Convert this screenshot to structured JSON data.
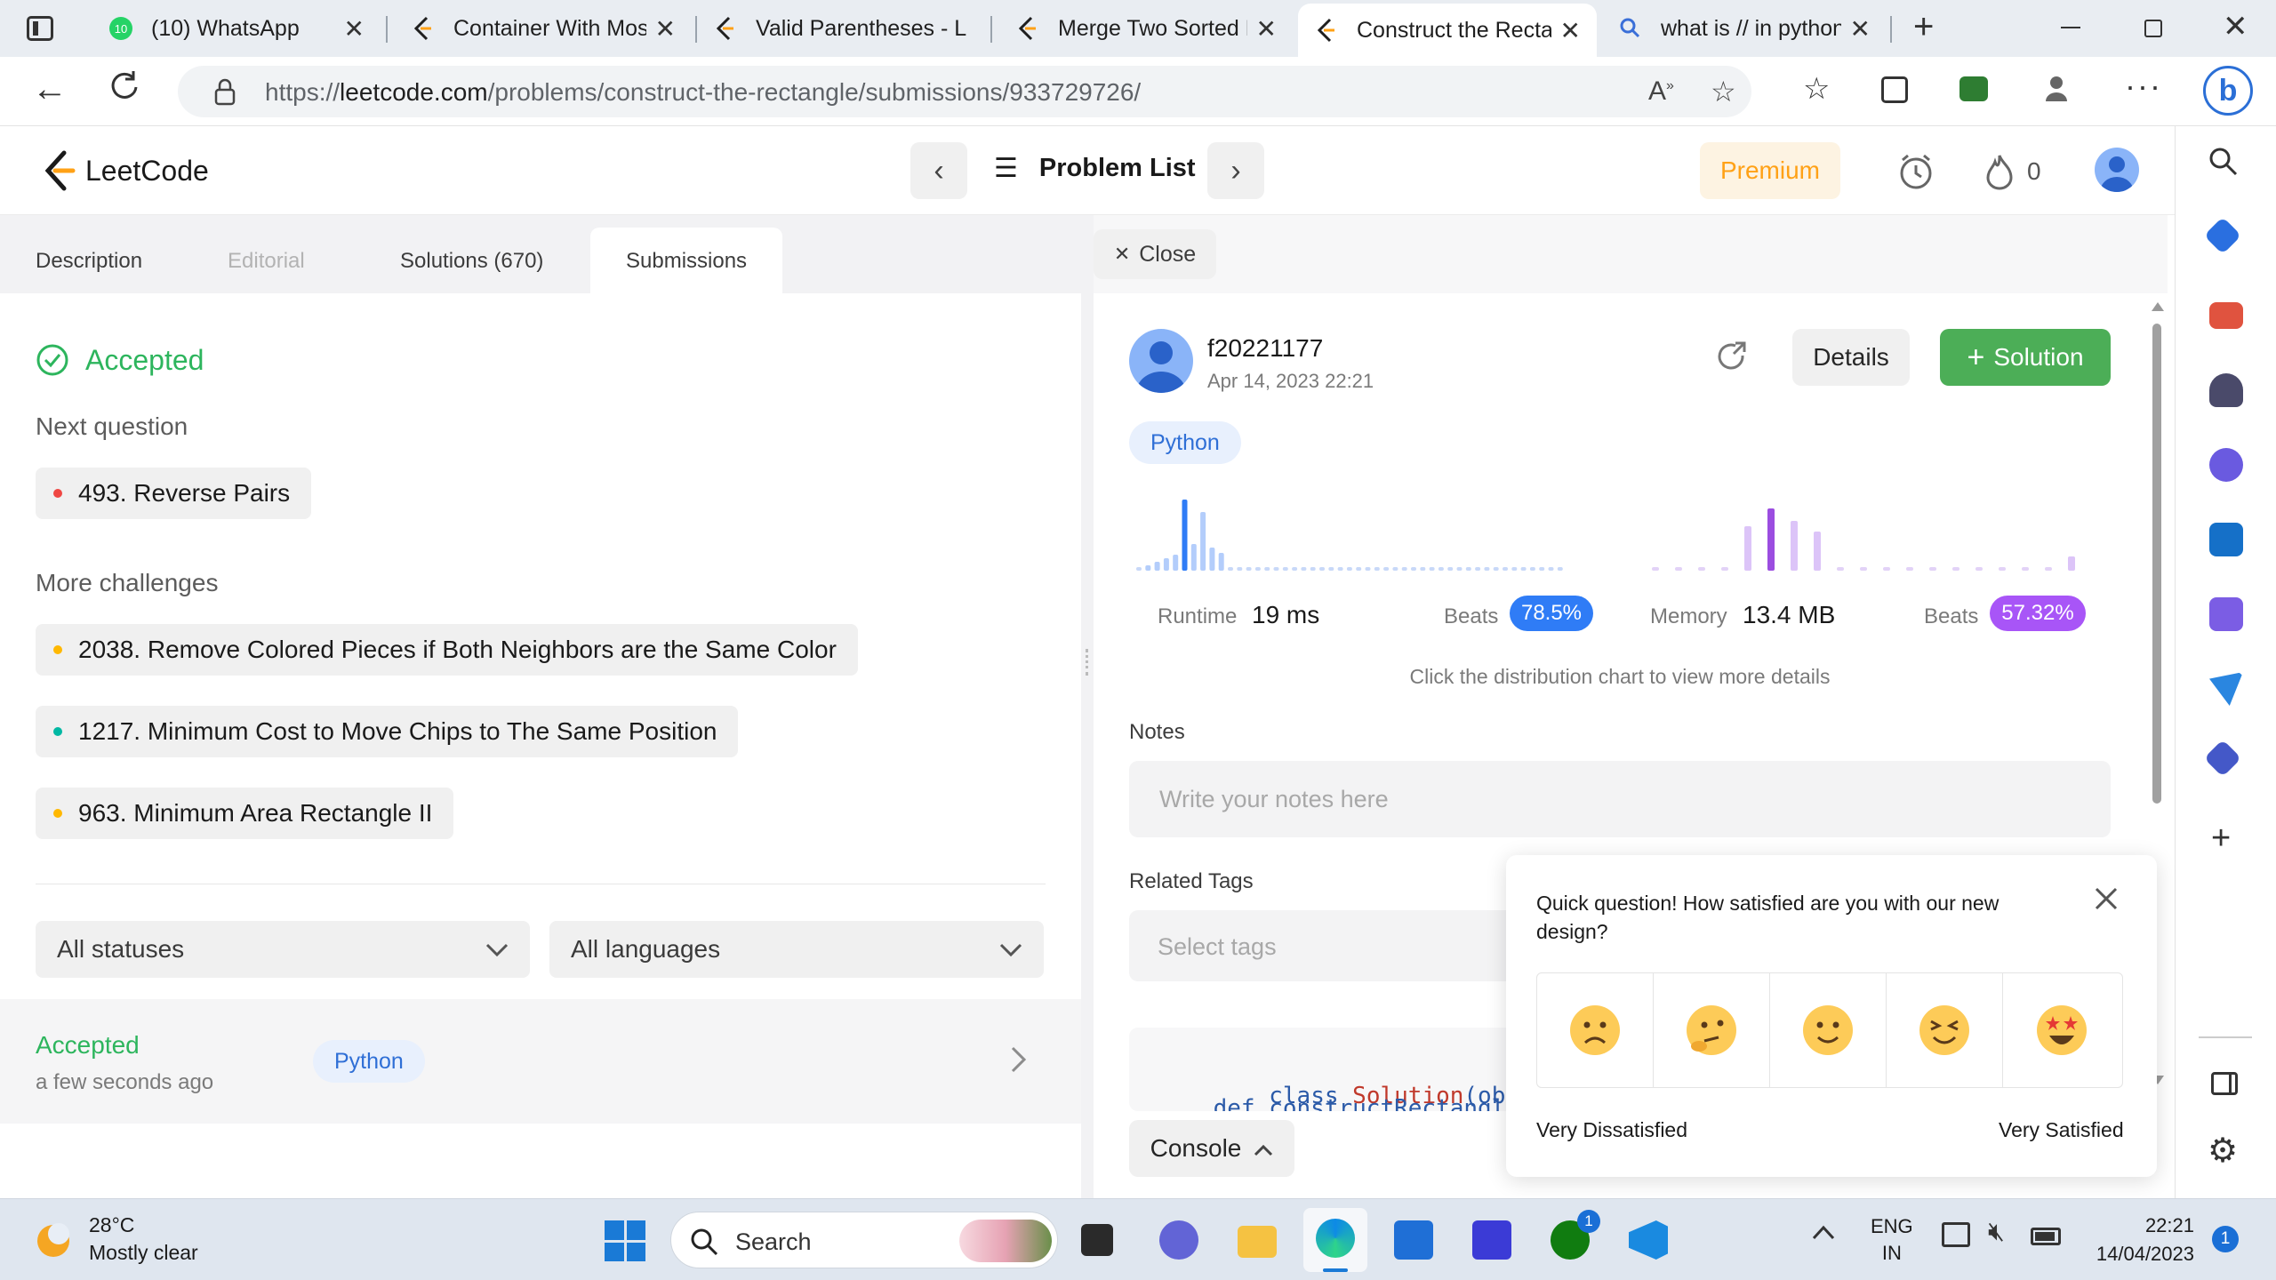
{
  "browser": {
    "tabs": [
      {
        "title": "(10) WhatsApp",
        "icon": "whatsapp-icon",
        "badge": "10"
      },
      {
        "title": "Container With Mos",
        "icon": "leetcode-icon"
      },
      {
        "title": "Valid Parentheses - L",
        "icon": "leetcode-icon"
      },
      {
        "title": "Merge Two Sorted L",
        "icon": "leetcode-icon"
      },
      {
        "title": "Construct the Recta",
        "icon": "leetcode-icon",
        "active": true
      },
      {
        "title": "what is // in python",
        "icon": "search-icon"
      }
    ],
    "url_prefix": "https://",
    "url_domain": "leetcode.com",
    "url_path": "/problems/construct-the-rectangle/submissions/933729726/"
  },
  "nav": {
    "logo_text": "LeetCode",
    "problem_list": "Problem List",
    "premium": "Premium",
    "streak": "0"
  },
  "left": {
    "tabs": [
      "Description",
      "Editorial",
      "Solutions (670)",
      "Submissions"
    ],
    "status": "Accepted",
    "next_question_label": "Next question",
    "next_question": "493. Reverse Pairs",
    "more_challenges_label": "More challenges",
    "challenges": [
      "2038. Remove Colored Pieces if Both Neighbors are the Same Color",
      "1217. Minimum Cost to Move Chips to The Same Position",
      "963. Minimum Area Rectangle II"
    ],
    "filter_status": "All statuses",
    "filter_language": "All languages",
    "submission": {
      "status": "Accepted",
      "time": "a few seconds ago",
      "language": "Python"
    }
  },
  "right": {
    "close_label": "Close",
    "username": "f20221177",
    "date": "Apr 14, 2023 22:21",
    "details_label": "Details",
    "solution_label": "Solution",
    "language": "Python",
    "runtime_label": "Runtime",
    "runtime_value": "19 ms",
    "runtime_beats_label": "Beats",
    "runtime_beats": "78.5%",
    "memory_label": "Memory",
    "memory_value": "13.4 MB",
    "memory_beats_label": "Beats",
    "memory_beats": "57.32%",
    "chart_hint": "Click the distribution chart to view more details",
    "notes_label": "Notes",
    "notes_placeholder": "Write your notes here",
    "tags_label": "Related Tags",
    "tags_placeholder": "Select tags",
    "code_line1_kw": "class",
    "code_line1_name": "Solution",
    "code_line1_rest": "(object):",
    "code_line2": "    def constructRectangl",
    "console_label": "Console"
  },
  "survey": {
    "question": "Quick question! How satisfied are you with our new design?",
    "low_label": "Very Dissatisfied",
    "high_label": "Very Satisfied"
  },
  "taskbar": {
    "weather_temp": "28°C",
    "weather_desc": "Mostly clear",
    "search_label": "Search",
    "lang_line1": "ENG",
    "lang_line2": "IN",
    "time": "22:21",
    "date": "14/04/2023",
    "notif_count": "1",
    "xbox_badge": "1"
  },
  "colors": {
    "accepted_green": "#2db55d",
    "runtime_blue": "#2f7cf6",
    "memory_purple": "#a855f7",
    "solution_green": "#4cae57",
    "premium_orange": "#ffa116"
  }
}
